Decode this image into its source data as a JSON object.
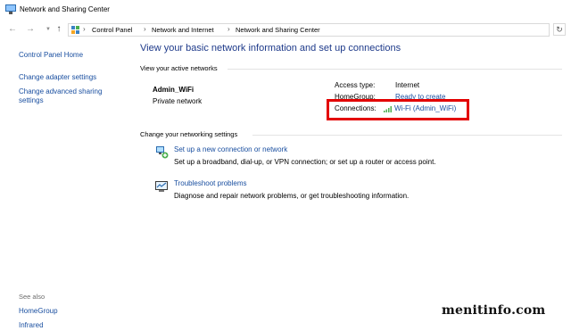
{
  "window": {
    "title": "Network and Sharing Center"
  },
  "navigation": {
    "breadcrumbs": [
      "Control Panel",
      "Network and Internet",
      "Network and Sharing Center"
    ]
  },
  "sidebar": {
    "links": [
      "Control Panel Home",
      "Change adapter settings",
      "Change advanced sharing",
      "settings"
    ],
    "see_also_label": "See also",
    "see_also_links": [
      "HomeGroup",
      "Infrared"
    ]
  },
  "main": {
    "heading": "View your basic network information and set up connections",
    "active_networks_label": "View your active networks",
    "network": {
      "name": "Admin_WiFi",
      "type": "Private network"
    },
    "info": {
      "access_type_label": "Access type:",
      "access_type_value": "Internet",
      "homegroup_label": "HomeGroup:",
      "homegroup_value": "Ready to create",
      "connections_label": "Connections:",
      "connections_value": "Wi-Fi (Admin_WiFi)"
    },
    "settings_label": "Change your networking settings",
    "tasks": [
      {
        "title": "Set up a new connection or network",
        "description": "Set up a broadband, dial-up, or VPN connection; or set up a router or access point."
      },
      {
        "title": "Troubleshoot problems",
        "description": "Diagnose and repair network problems, or get troubleshooting information."
      }
    ]
  },
  "watermark": "menitinfo.com",
  "colors": {
    "link": "#1a4fa0",
    "heading": "#1e3a8a",
    "highlight": "#e30000"
  },
  "icons": [
    "network-center-icon",
    "back-arrow-icon",
    "forward-arrow-icon",
    "up-arrow-icon",
    "control-panel-icon",
    "refresh-icon",
    "wifi-signal-icon",
    "new-connection-icon",
    "troubleshoot-icon"
  ]
}
